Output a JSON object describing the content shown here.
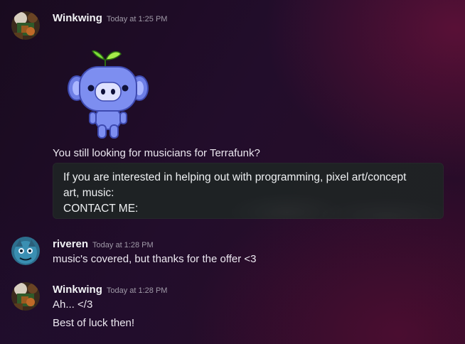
{
  "messages": [
    {
      "username": "Winkwing",
      "timestamp": "Today at 1:25 PM",
      "sticker": "wumpus-sprout-sticker",
      "text": "You still looking for musicians for Terrafunk?",
      "embed": {
        "lines": [
          "If you are interested in helping out with programming, pixel art/concept",
          "art, music:",
          "CONTACT ME:"
        ]
      }
    },
    {
      "username": "riveren",
      "timestamp": "Today at 1:28 PM",
      "text": "music's covered, but thanks for the offer <3"
    },
    {
      "username": "Winkwing",
      "timestamp": "Today at 1:28 PM",
      "lines": [
        "Ah... </3",
        "Best of luck then!"
      ]
    }
  ],
  "colors": {
    "username": "#f2f3f5",
    "timestamp": "#a09aa8",
    "wumpus": "#7d8ef0",
    "sprout": "#7ddc3a"
  }
}
